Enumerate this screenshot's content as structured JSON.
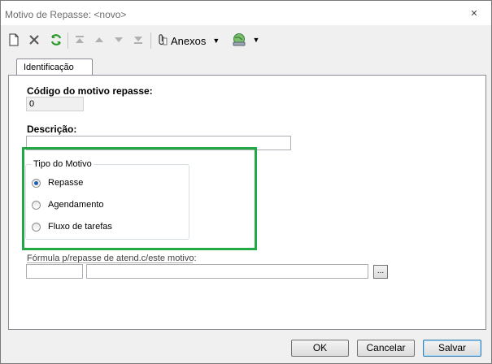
{
  "window": {
    "title": "Motivo de Repasse: <novo>",
    "close_glyph": "✕"
  },
  "toolbar": {
    "buttons": [
      {
        "name": "new-document-icon"
      },
      {
        "name": "delete-icon"
      },
      {
        "name": "refresh-icon"
      },
      {
        "name": "first-record-icon"
      },
      {
        "name": "previous-record-icon"
      },
      {
        "name": "next-record-icon"
      },
      {
        "name": "last-record-icon"
      }
    ],
    "anexos_label": "Anexos",
    "dropdown_glyph": "▼"
  },
  "tabs": [
    {
      "label": "Identificação",
      "active": true
    }
  ],
  "form": {
    "codigo_label": "Código do motivo repasse:",
    "codigo_value": "0",
    "descricao_label": "Descrição:",
    "descricao_value": "",
    "tipo_group_title": "Tipo do Motivo",
    "tipo_options": [
      {
        "label": "Repasse",
        "selected": true
      },
      {
        "label": "Agendamento",
        "selected": false
      },
      {
        "label": "Fluxo de tarefas",
        "selected": false
      }
    ],
    "formula_label": "Fórmula p/repasse de atend.c/este motivo:",
    "formula_code_value": "",
    "formula_desc_value": "",
    "browse_label": "..."
  },
  "footer": {
    "ok_label": "OK",
    "cancel_label": "Cancelar",
    "save_label": "Salvar"
  },
  "colors": {
    "highlight": "#22a845",
    "radio_selected": "#1f5fb3",
    "default_button_border": "#3c7fb1"
  }
}
